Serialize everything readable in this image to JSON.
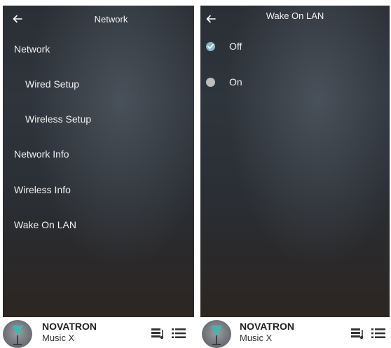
{
  "network_screen": {
    "title": "Network",
    "items": [
      {
        "label": "Network"
      },
      {
        "label": "Wired Setup"
      },
      {
        "label": "Wireless Setup"
      },
      {
        "label": "Network Info"
      },
      {
        "label": "Wireless Info"
      },
      {
        "label": "Wake On LAN"
      }
    ]
  },
  "wol_screen": {
    "title": "Wake On LAN",
    "options": [
      {
        "label": "Off",
        "selected": true
      },
      {
        "label": "On",
        "selected": false
      }
    ]
  },
  "now_playing": {
    "device": "NOVATRON",
    "source": "Music X"
  },
  "colors": {
    "panel_bg": "#2e343b",
    "accent_check": "#8fb6c8",
    "radio_unchecked": "#bdbdbd"
  },
  "icons": {
    "back": "back-arrow-icon",
    "queue": "queue-music-icon",
    "list": "list-icon",
    "check": "checkmark-icon"
  }
}
